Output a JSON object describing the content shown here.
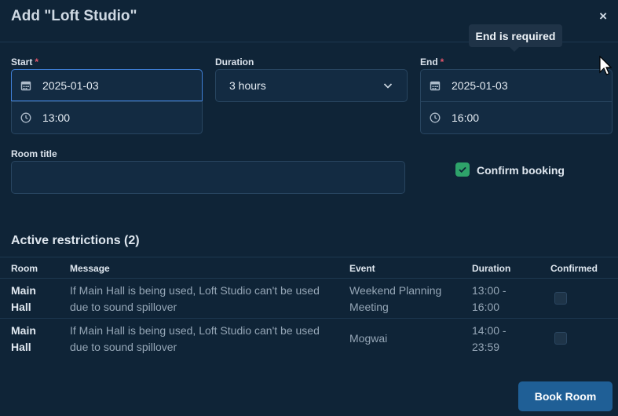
{
  "dialog": {
    "title": "Add \"Loft Studio\"",
    "close": "×"
  },
  "start": {
    "label": "Start",
    "required": "*",
    "date": "2025-01-03",
    "time": "13:00"
  },
  "duration": {
    "label": "Duration",
    "value": "3 hours"
  },
  "end": {
    "label": "End",
    "required": "*",
    "date": "2025-01-03",
    "time": "16:00",
    "tooltip": "End is required"
  },
  "room_title": {
    "label": "Room title",
    "value": ""
  },
  "confirm": {
    "label": "Confirm booking",
    "checked": true
  },
  "restrictions": {
    "heading": "Active restrictions (2)",
    "columns": [
      "Room",
      "Message",
      "Event",
      "Duration",
      "Confirmed"
    ],
    "rows": [
      {
        "room": "Main Hall",
        "message": "If Main Hall is being used, Loft Studio can't be used due to sound spillover",
        "event": "Weekend Planning Meeting",
        "duration": "13:00 - 16:00",
        "confirmed": false
      },
      {
        "room": "Main Hall",
        "message": "If Main Hall is being used, Loft Studio can't be used due to sound spillover",
        "event": "Mogwai",
        "duration": "14:00 - 23:59",
        "confirmed": false
      }
    ]
  },
  "actions": {
    "book": "Book Room"
  },
  "colors": {
    "accent": "#3f7fd6",
    "required": "#e0556a",
    "check": "#2ea36a",
    "primary_button": "#1f5f96"
  }
}
